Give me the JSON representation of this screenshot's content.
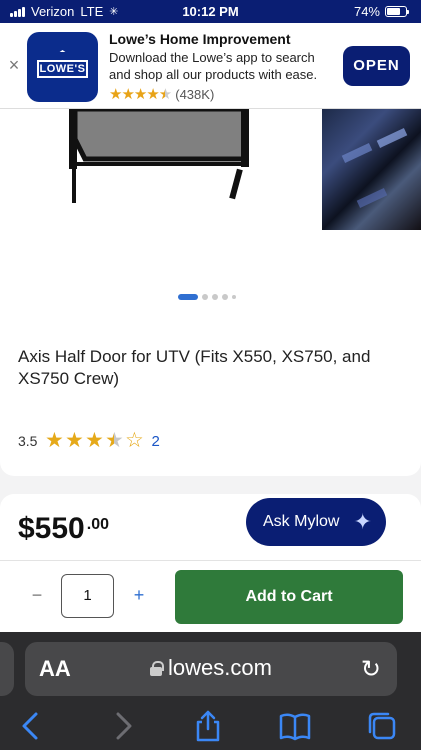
{
  "status_bar": {
    "carrier": "Verizon",
    "network": "LTE",
    "time": "10:12 PM",
    "battery": "74%",
    "battery_level": 0.74
  },
  "app_banner": {
    "title": "Lowe’s Home Improvement",
    "subtitle": "Download the Lowe’s app to search and shop all our products with ease.",
    "rating_count": "(438K)",
    "rating_value": 4.5,
    "icon_text": "LOWE'S",
    "open_label": "OPEN"
  },
  "product": {
    "title": "Axis Half Door for UTV (Fits X550, XS750, and XS750 Crew)",
    "rating": "3.5",
    "rating_value": 3.5,
    "review_count": "2",
    "carousel_dots": 5,
    "active_dot": 0
  },
  "price": {
    "dollars": "$550",
    "cents": ".00"
  },
  "assistant": {
    "label": "Ask Mylow"
  },
  "cart": {
    "quantity": "1",
    "minus_label": "−",
    "plus_label": "+",
    "add_label": "Add to Cart"
  },
  "browser": {
    "aa_label": "AA",
    "url": "lowes.com"
  },
  "colors": {
    "brand_navy": "#0a1e73",
    "cart_green": "#2f7a3a",
    "star_gold": "#e5a91a",
    "link_blue": "#1a56c6",
    "safari_blue": "#3b87f5"
  }
}
